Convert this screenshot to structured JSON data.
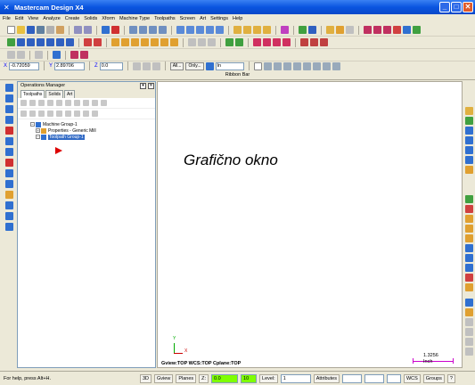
{
  "window": {
    "title": "Mastercam Design X4"
  },
  "menu": [
    "File",
    "Edit",
    "View",
    "Analyze",
    "Create",
    "Solids",
    "Xform",
    "Machine Type",
    "Toolpaths",
    "Screen",
    "Art",
    "Settings",
    "Help"
  ],
  "fields": {
    "x_label": "X",
    "x_value": "-0.72059",
    "y_label": "Y",
    "y_value": "2.89706",
    "z_label": "Z",
    "z_value": "0.0",
    "all_button": "All...",
    "only_button": "Only...",
    "mode_value": "In"
  },
  "ribbon": {
    "label": "Ribbon Bar"
  },
  "ops_manager": {
    "title": "Operations Manager",
    "tabs": [
      "Toolpaths",
      "Solids",
      "Art"
    ],
    "tree": [
      {
        "label": "Machine Group-1",
        "level": 0
      },
      {
        "label": "Properties - Generic Mill",
        "level": 1
      },
      {
        "label": "Toolpath Group-1",
        "level": 1,
        "selected": true
      }
    ]
  },
  "graphics": {
    "window_label": "Grafično okno",
    "axis_x": "X",
    "axis_y": "Y",
    "view_info": "Gview:TOP  WCS:TOP  Cplane:TOP",
    "scale_value": "1.3256",
    "scale_unit": "Inch"
  },
  "status": {
    "help": "For help, press Alt+H.",
    "three_d": "3D",
    "gview": "Gview",
    "planes": "Planes",
    "z_label": "Z:",
    "z_value": "0.0",
    "color_value": "10",
    "level_label": "Level:",
    "level_value": "1",
    "attributes": "Attributes",
    "wcs": "WCS",
    "groups": "Groups"
  },
  "colors": {
    "titlebar": "#0a55e0",
    "selection": "#316ac5",
    "accent_green": "#7fff00"
  }
}
